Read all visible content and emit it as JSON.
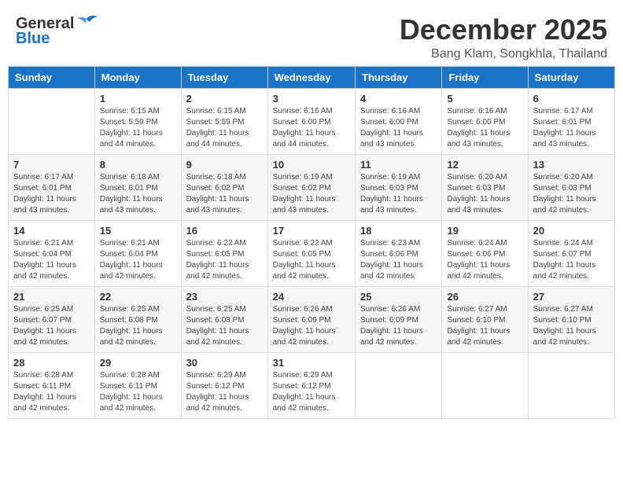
{
  "header": {
    "logo_line1": "General",
    "logo_line2": "Blue",
    "month": "December 2025",
    "location": "Bang Klam, Songkhla, Thailand"
  },
  "weekdays": [
    "Sunday",
    "Monday",
    "Tuesday",
    "Wednesday",
    "Thursday",
    "Friday",
    "Saturday"
  ],
  "weeks": [
    [
      {
        "day": "",
        "sunrise": "",
        "sunset": "",
        "daylight": ""
      },
      {
        "day": "1",
        "sunrise": "Sunrise: 6:15 AM",
        "sunset": "Sunset: 5:59 PM",
        "daylight": "Daylight: 11 hours and 44 minutes."
      },
      {
        "day": "2",
        "sunrise": "Sunrise: 6:15 AM",
        "sunset": "Sunset: 5:59 PM",
        "daylight": "Daylight: 11 hours and 44 minutes."
      },
      {
        "day": "3",
        "sunrise": "Sunrise: 6:16 AM",
        "sunset": "Sunset: 6:00 PM",
        "daylight": "Daylight: 11 hours and 44 minutes."
      },
      {
        "day": "4",
        "sunrise": "Sunrise: 6:16 AM",
        "sunset": "Sunset: 6:00 PM",
        "daylight": "Daylight: 11 hours and 43 minutes."
      },
      {
        "day": "5",
        "sunrise": "Sunrise: 6:16 AM",
        "sunset": "Sunset: 6:00 PM",
        "daylight": "Daylight: 11 hours and 43 minutes."
      },
      {
        "day": "6",
        "sunrise": "Sunrise: 6:17 AM",
        "sunset": "Sunset: 6:01 PM",
        "daylight": "Daylight: 11 hours and 43 minutes."
      }
    ],
    [
      {
        "day": "7",
        "sunrise": "Sunrise: 6:17 AM",
        "sunset": "Sunset: 6:01 PM",
        "daylight": "Daylight: 11 hours and 43 minutes."
      },
      {
        "day": "8",
        "sunrise": "Sunrise: 6:18 AM",
        "sunset": "Sunset: 6:01 PM",
        "daylight": "Daylight: 11 hours and 43 minutes."
      },
      {
        "day": "9",
        "sunrise": "Sunrise: 6:18 AM",
        "sunset": "Sunset: 6:02 PM",
        "daylight": "Daylight: 11 hours and 43 minutes."
      },
      {
        "day": "10",
        "sunrise": "Sunrise: 6:19 AM",
        "sunset": "Sunset: 6:02 PM",
        "daylight": "Daylight: 11 hours and 43 minutes."
      },
      {
        "day": "11",
        "sunrise": "Sunrise: 6:19 AM",
        "sunset": "Sunset: 6:03 PM",
        "daylight": "Daylight: 11 hours and 43 minutes."
      },
      {
        "day": "12",
        "sunrise": "Sunrise: 6:20 AM",
        "sunset": "Sunset: 6:03 PM",
        "daylight": "Daylight: 11 hours and 43 minutes."
      },
      {
        "day": "13",
        "sunrise": "Sunrise: 6:20 AM",
        "sunset": "Sunset: 6:03 PM",
        "daylight": "Daylight: 11 hours and 42 minutes."
      }
    ],
    [
      {
        "day": "14",
        "sunrise": "Sunrise: 6:21 AM",
        "sunset": "Sunset: 6:04 PM",
        "daylight": "Daylight: 11 hours and 42 minutes."
      },
      {
        "day": "15",
        "sunrise": "Sunrise: 6:21 AM",
        "sunset": "Sunset: 6:04 PM",
        "daylight": "Daylight: 11 hours and 42 minutes."
      },
      {
        "day": "16",
        "sunrise": "Sunrise: 6:22 AM",
        "sunset": "Sunset: 6:05 PM",
        "daylight": "Daylight: 11 hours and 42 minutes."
      },
      {
        "day": "17",
        "sunrise": "Sunrise: 6:22 AM",
        "sunset": "Sunset: 6:05 PM",
        "daylight": "Daylight: 11 hours and 42 minutes."
      },
      {
        "day": "18",
        "sunrise": "Sunrise: 6:23 AM",
        "sunset": "Sunset: 6:06 PM",
        "daylight": "Daylight: 11 hours and 42 minutes."
      },
      {
        "day": "19",
        "sunrise": "Sunrise: 6:24 AM",
        "sunset": "Sunset: 6:06 PM",
        "daylight": "Daylight: 11 hours and 42 minutes."
      },
      {
        "day": "20",
        "sunrise": "Sunrise: 6:24 AM",
        "sunset": "Sunset: 6:07 PM",
        "daylight": "Daylight: 11 hours and 42 minutes."
      }
    ],
    [
      {
        "day": "21",
        "sunrise": "Sunrise: 6:25 AM",
        "sunset": "Sunset: 6:07 PM",
        "daylight": "Daylight: 11 hours and 42 minutes."
      },
      {
        "day": "22",
        "sunrise": "Sunrise: 6:25 AM",
        "sunset": "Sunset: 6:08 PM",
        "daylight": "Daylight: 11 hours and 42 minutes."
      },
      {
        "day": "23",
        "sunrise": "Sunrise: 6:25 AM",
        "sunset": "Sunset: 6:08 PM",
        "daylight": "Daylight: 11 hours and 42 minutes."
      },
      {
        "day": "24",
        "sunrise": "Sunrise: 6:26 AM",
        "sunset": "Sunset: 6:09 PM",
        "daylight": "Daylight: 11 hours and 42 minutes."
      },
      {
        "day": "25",
        "sunrise": "Sunrise: 6:26 AM",
        "sunset": "Sunset: 6:09 PM",
        "daylight": "Daylight: 11 hours and 42 minutes."
      },
      {
        "day": "26",
        "sunrise": "Sunrise: 6:27 AM",
        "sunset": "Sunset: 6:10 PM",
        "daylight": "Daylight: 11 hours and 42 minutes."
      },
      {
        "day": "27",
        "sunrise": "Sunrise: 6:27 AM",
        "sunset": "Sunset: 6:10 PM",
        "daylight": "Daylight: 11 hours and 42 minutes."
      }
    ],
    [
      {
        "day": "28",
        "sunrise": "Sunrise: 6:28 AM",
        "sunset": "Sunset: 6:11 PM",
        "daylight": "Daylight: 11 hours and 42 minutes."
      },
      {
        "day": "29",
        "sunrise": "Sunrise: 6:28 AM",
        "sunset": "Sunset: 6:11 PM",
        "daylight": "Daylight: 11 hours and 42 minutes."
      },
      {
        "day": "30",
        "sunrise": "Sunrise: 6:29 AM",
        "sunset": "Sunset: 6:12 PM",
        "daylight": "Daylight: 11 hours and 42 minutes."
      },
      {
        "day": "31",
        "sunrise": "Sunrise: 6:29 AM",
        "sunset": "Sunset: 6:12 PM",
        "daylight": "Daylight: 11 hours and 42 minutes."
      },
      {
        "day": "",
        "sunrise": "",
        "sunset": "",
        "daylight": ""
      },
      {
        "day": "",
        "sunrise": "",
        "sunset": "",
        "daylight": ""
      },
      {
        "day": "",
        "sunrise": "",
        "sunset": "",
        "daylight": ""
      }
    ]
  ]
}
